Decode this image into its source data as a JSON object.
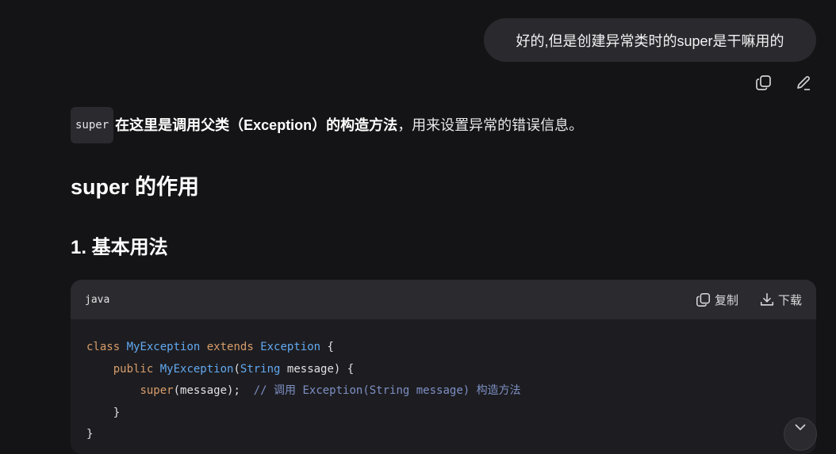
{
  "user_message": {
    "text": "好的,但是创建异常类时的super是干嘛用的"
  },
  "message_actions": {
    "copy_icon": "copy-icon",
    "edit_icon": "pencil-icon"
  },
  "answer": {
    "intro": {
      "code": "super",
      "bold_text": "在这里是调用父类（Exception）的构造方法",
      "rest_text": "，用来设置异常的错误信息。"
    },
    "heading": "super 的作用",
    "subheading": "1. 基本用法"
  },
  "code_block": {
    "language": "java",
    "copy_label": "复制",
    "download_label": "下载",
    "lines": {
      "l1_kw": "class",
      "l1_cls": "MyException",
      "l1_kw2": "extends",
      "l1_cls2": "Exception",
      "l1_end": "{",
      "l2_kw": "public",
      "l2_cls": "MyException",
      "l2_paren": "(",
      "l2_type": "String",
      "l2_rest": "message) {",
      "l3_kw": "super",
      "l3_rest": "(message);",
      "l3_comment": "// 调用 Exception(String message) 构造方法",
      "l4": "}",
      "l5": "}"
    }
  },
  "colors": {
    "background": "#141416",
    "bubble": "#2a2a2e",
    "keyword": "#d89d6a",
    "class_name": "#62a9f0",
    "comment": "#7d8fc4"
  }
}
